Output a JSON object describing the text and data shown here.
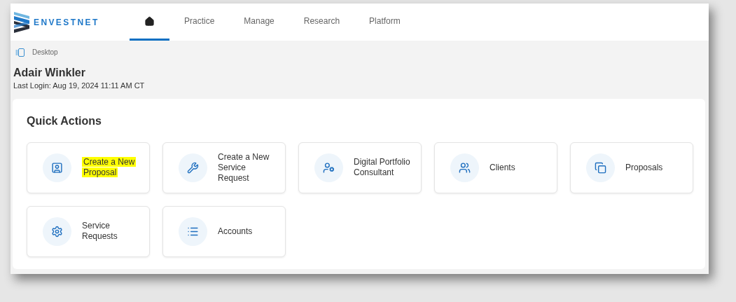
{
  "brand": {
    "name": "ENVESTNET"
  },
  "nav": [
    {
      "kind": "home",
      "selected": true
    },
    {
      "label": "Practice",
      "selected": false
    },
    {
      "label": "Manage",
      "selected": false
    },
    {
      "label": "Research",
      "selected": false
    },
    {
      "label": "Platform",
      "selected": false
    }
  ],
  "breadcrumb": "Desktop",
  "user": {
    "name": "Adair Winkler",
    "last_login": "Last Login: Aug 19, 2024 11:11 AM CT"
  },
  "quick_actions": {
    "title": "Quick Actions",
    "items": [
      {
        "label": "Create a New Proposal",
        "highlighted": true
      },
      {
        "label": "Create a New Service Request",
        "highlighted": false
      },
      {
        "label": "Digital Portfolio Consultant",
        "highlighted": false
      },
      {
        "label": "Clients",
        "highlighted": false
      },
      {
        "label": "Proposals",
        "highlighted": false
      },
      {
        "label": "Service Requests",
        "highlighted": false
      },
      {
        "label": "Accounts",
        "highlighted": false
      }
    ]
  }
}
